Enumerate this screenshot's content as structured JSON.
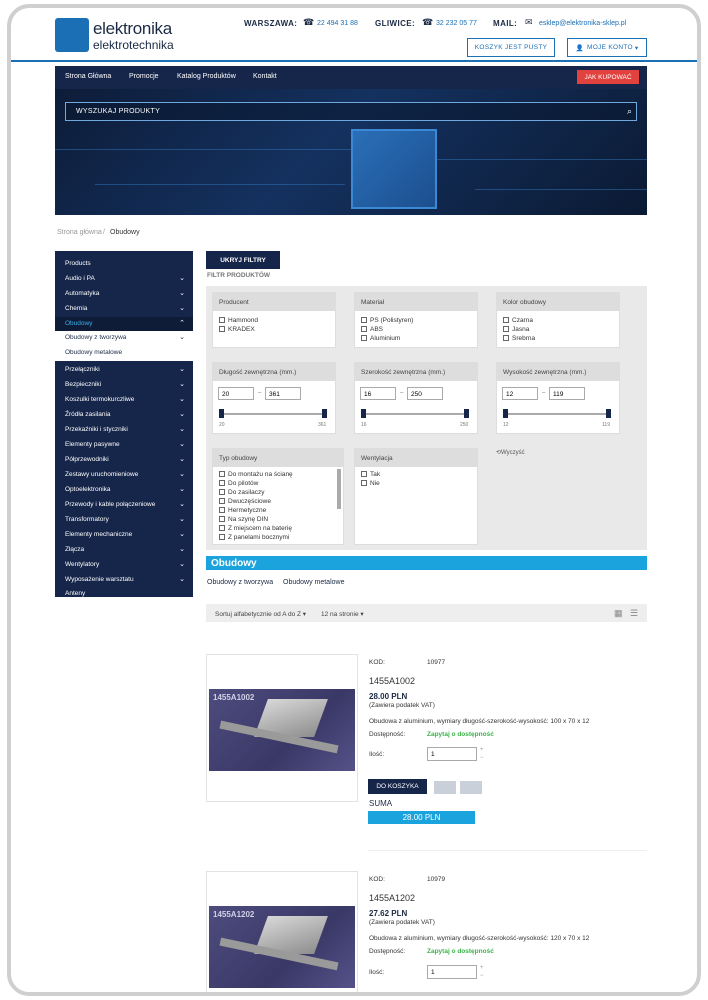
{
  "logo": {
    "line1": "elektronika",
    "line2": "elektrotechnika"
  },
  "contact": {
    "warszawa_label": "WARSZAWA:",
    "warszawa_phone": "22 494 31 88",
    "gliwice_label": "GLIWICE:",
    "gliwice_phone": "32 232 05 77",
    "mail_label": "MAIL:",
    "mail_value": "esklep@elektronika-sklep.pl"
  },
  "header_buttons": {
    "cart": "KOSZYK JEST PUSTY",
    "account": "MOJE KONTO"
  },
  "nav": {
    "items": [
      "Strona Główna",
      "Promocje",
      "Katalog Produktów",
      "Kontakt"
    ],
    "cta": "JAK KUPOWAĆ"
  },
  "search": {
    "placeholder": "WYSZUKAJ PRODUKTY"
  },
  "breadcrumb": {
    "home": "Strona główna",
    "sep": "/",
    "current": "Obudowy"
  },
  "sidebar": {
    "items": [
      {
        "label": "Products"
      },
      {
        "label": "Audio i PA"
      },
      {
        "label": "Automatyka"
      },
      {
        "label": "Chemia"
      },
      {
        "label": "Obudowy"
      },
      {
        "label": "Obudowy z tworzywa"
      },
      {
        "label": "Obudowy metalowe"
      },
      {
        "label": "Przełączniki"
      },
      {
        "label": "Bezpieczniki"
      },
      {
        "label": "Koszulki termokurczliwe"
      },
      {
        "label": "Źródła zasilania"
      },
      {
        "label": "Przekaźniki i styczniki"
      },
      {
        "label": "Elementy pasywne"
      },
      {
        "label": "Półprzewodniki"
      },
      {
        "label": "Zestawy uruchomieniowe"
      },
      {
        "label": "Optoelektronika"
      },
      {
        "label": "Przewody i kable połączeniowe"
      },
      {
        "label": "Transformatory"
      },
      {
        "label": "Elementy mechaniczne"
      },
      {
        "label": "Złącza"
      },
      {
        "label": "Wentylatory"
      },
      {
        "label": "Wyposażenie warsztatu"
      },
      {
        "label": "Anteny"
      }
    ]
  },
  "filters": {
    "hide_button": "UKRYJ FILTRY",
    "title": "FILTR PRODUKTÓW",
    "producent": {
      "title": "Producent",
      "options": [
        "Hammond",
        "KRADEX"
      ]
    },
    "material": {
      "title": "Materiał",
      "options": [
        "PS (Polistyren)",
        "ABS",
        "Aluminium"
      ]
    },
    "kolor": {
      "title": "Kolor obudowy",
      "options": [
        "Czarna",
        "Jasna",
        "Srebrna"
      ]
    },
    "dlugosc": {
      "title": "Długość zewnętrzna (mm.)",
      "min": "20",
      "max": "361",
      "tick_min": "20",
      "tick_max": "361"
    },
    "szerokosc": {
      "title": "Szerokość zewnętrzna (mm.)",
      "min": "16",
      "max": "250",
      "tick_min": "16",
      "tick_max": "250"
    },
    "wysokosc": {
      "title": "Wysokość zewnętrzna (mm.)",
      "min": "12",
      "max": "119",
      "tick_min": "12",
      "tick_max": "119"
    },
    "dash": "–",
    "typ": {
      "title": "Typ obudowy",
      "options": [
        "Do montażu na ścianę",
        "Do pilotów",
        "Do zasilaczy",
        "Dwuczęściowe",
        "Hermetyczne",
        "Na szynę DIN",
        "Z miejscem na baterię",
        "Z panelami bocznymi"
      ]
    },
    "wentylacja": {
      "title": "Wentylacja",
      "options": [
        "Tak",
        "Nie"
      ]
    },
    "clear": "Wyczyść"
  },
  "section": {
    "title": "Obudowy",
    "subcats": [
      "Obudowy z tworzywa",
      "Obudowy metalowe"
    ]
  },
  "sort": {
    "order": "Sortuj alfabetycznie od A do Z",
    "per_page": "12 na stronie"
  },
  "products": [
    {
      "kod_label": "KOD:",
      "kod": "10977",
      "name": "1455A1002",
      "image_label": "1455A1002",
      "price": "28.00 PLN",
      "vat": "(Zawiera podatek VAT)",
      "desc": "Obudowa z aluminium, wymiary długość-szerokość-wysokość: 100 x 70 x 12",
      "avail_label": "Dostępność:",
      "avail": "Zapytaj o dostępność",
      "qty_label": "Ilość:",
      "qty": "1",
      "add": "DO KOSZYKA",
      "suma_label": "SUMA",
      "suma": "28.00 PLN"
    },
    {
      "kod_label": "KOD:",
      "kod": "10979",
      "name": "1455A1202",
      "image_label": "1455A1202",
      "price": "27.62 PLN",
      "vat": "(Zawiera podatek VAT)",
      "desc": "Obudowa z aluminium, wymiary długość-szerokość-wysokość: 120 x 70 x 12",
      "avail_label": "Dostępność:",
      "avail": "Zapytaj o dostępność",
      "qty_label": "Ilość:",
      "qty": "1"
    }
  ],
  "colors": {
    "navy": "#16264a",
    "accent_blue": "#1ba3dd",
    "link_blue": "#1a6fb5",
    "cta_red": "#e2423e",
    "avail_green": "#3bb34a"
  }
}
